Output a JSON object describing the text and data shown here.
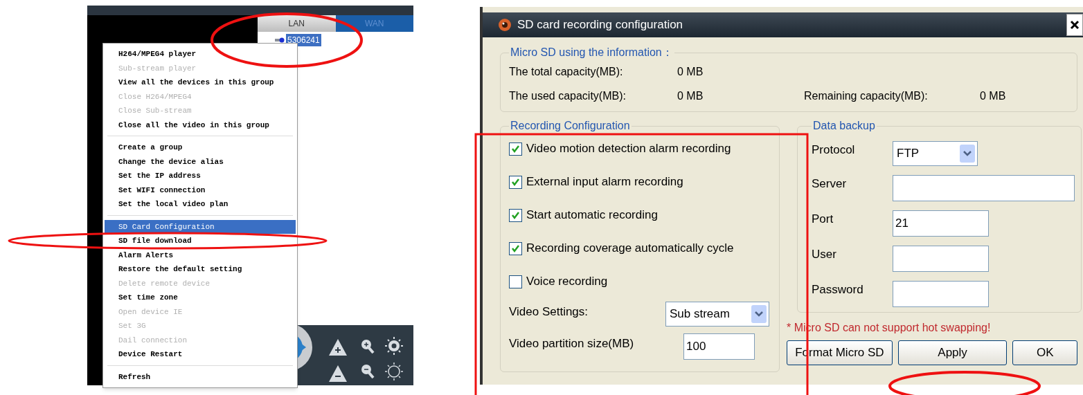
{
  "tabs": [
    {
      "label": "LAN",
      "selected": true
    },
    {
      "label": "WAN",
      "selected": false
    }
  ],
  "devices": [
    {
      "label": "5306241",
      "selected": true
    }
  ],
  "context_menu": {
    "groups": [
      [
        {
          "label": "H264/MPEG4 player",
          "disabled": false,
          "selected": false
        },
        {
          "label": "Sub-stream player",
          "disabled": true,
          "selected": false
        },
        {
          "label": "View all the devices in this group",
          "disabled": false,
          "selected": false
        },
        {
          "label": "Close H264/MPEG4",
          "disabled": true,
          "selected": false
        },
        {
          "label": "Close Sub-stream",
          "disabled": true,
          "selected": false
        },
        {
          "label": "Close all the video in this group",
          "disabled": false,
          "selected": false
        }
      ],
      [
        {
          "label": "Create a group",
          "disabled": false,
          "selected": false
        },
        {
          "label": "Change the device alias",
          "disabled": false,
          "selected": false
        },
        {
          "label": "Set the IP address",
          "disabled": false,
          "selected": false
        },
        {
          "label": "Set WIFI connection",
          "disabled": false,
          "selected": false
        },
        {
          "label": "Set the local video plan",
          "disabled": false,
          "selected": false
        }
      ],
      [
        {
          "label": "SD Card Configuration",
          "disabled": false,
          "selected": true
        },
        {
          "label": "SD file download",
          "disabled": false,
          "selected": false
        },
        {
          "label": "Alarm Alerts",
          "disabled": false,
          "selected": false
        },
        {
          "label": "Restore the default setting",
          "disabled": false,
          "selected": false
        },
        {
          "label": "Delete remote device",
          "disabled": true,
          "selected": false
        },
        {
          "label": "Set time zone",
          "disabled": false,
          "selected": false
        },
        {
          "label": "Open device IE",
          "disabled": true,
          "selected": false
        },
        {
          "label": "Set 3G",
          "disabled": true,
          "selected": false
        },
        {
          "label": "Dail connection",
          "disabled": true,
          "selected": false
        },
        {
          "label": "Device Restart",
          "disabled": false,
          "selected": false
        }
      ],
      [
        {
          "label": "Refresh",
          "disabled": false,
          "selected": false
        }
      ]
    ]
  },
  "dialog": {
    "title": "SD card recording configuration",
    "info": {
      "heading": "Micro SD using the information：",
      "total_label": "The total capacity(MB):",
      "total_value": "0 MB",
      "used_label": "The used capacity(MB):",
      "used_value": "0 MB",
      "remaining_label": "Remaining capacity(MB):",
      "remaining_value": "0 MB"
    },
    "recording": {
      "heading": "Recording Configuration",
      "options": [
        {
          "label": "Video motion detection alarm recording",
          "checked": true
        },
        {
          "label": "External input alarm recording",
          "checked": true
        },
        {
          "label": "Start automatic recording",
          "checked": true
        },
        {
          "label": "Recording coverage automatically cycle",
          "checked": true
        },
        {
          "label": "Voice recording",
          "checked": false
        }
      ],
      "video_settings": {
        "label": "Video Settings:",
        "value": "Sub stream"
      },
      "partition": {
        "label": "Video partition size(MB)",
        "value": "100"
      }
    },
    "backup": {
      "heading": "Data backup",
      "fields": [
        {
          "label": "Protocol",
          "kind": "select",
          "value": "FTP"
        },
        {
          "label": "Server",
          "kind": "wide"
        },
        {
          "label": "Port",
          "kind": "text",
          "value": "21"
        },
        {
          "label": "User",
          "kind": "text"
        },
        {
          "label": "Password",
          "kind": "text"
        }
      ]
    },
    "warning": "* Micro SD can not support hot swapping!",
    "buttons": [
      "Format Micro SD",
      "Apply",
      "OK"
    ]
  }
}
